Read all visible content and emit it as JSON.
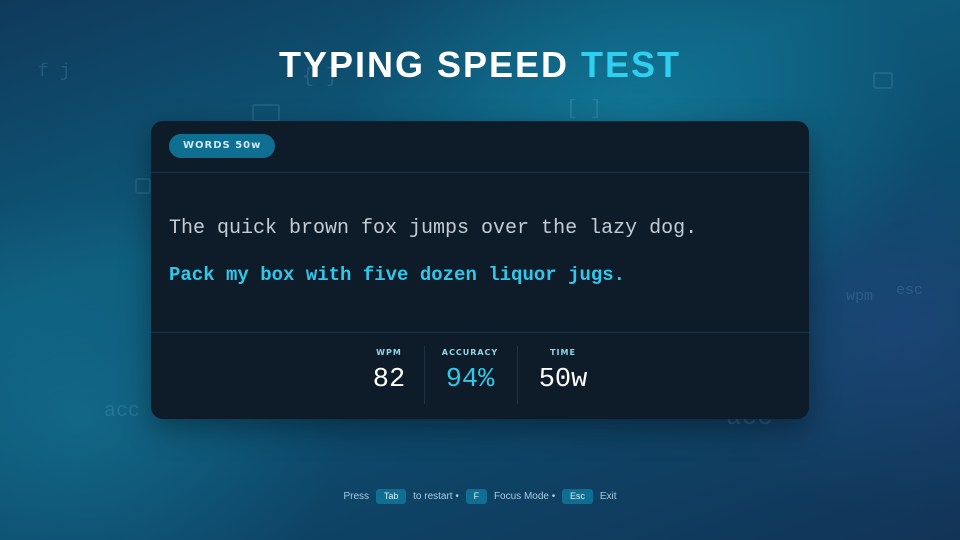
{
  "title": {
    "main": "TYPING SPEED",
    "accent": "TEST"
  },
  "card": {
    "badge": "WORDS 50w",
    "line_typed": "The quick brown fox jumps over the lazy dog.",
    "line_current": "Pack my box with five dozen liquor jugs."
  },
  "stats": [
    {
      "label": "WPM",
      "value": "82"
    },
    {
      "label": "ACCURACY",
      "value": "94%"
    },
    {
      "label": "TIME",
      "value": "50w"
    }
  ],
  "footer": {
    "press": "Press",
    "key_tab": "Tab",
    "restart": "to restart •",
    "key_f": "F",
    "focus": "Focus Mode •",
    "key_esc": "Esc",
    "exit": "Exit"
  },
  "background_glyphs": {
    "g1": "wpm",
    "g2": "esc",
    "g3": "acc",
    "g4": "acc",
    "g5": "{ }",
    "g6": "[ ]",
    "g7": "f j"
  },
  "colors": {
    "accent": "#2fd0ef",
    "card_bg": "#0e1c2a",
    "badge_bg": "#0f6f92"
  }
}
